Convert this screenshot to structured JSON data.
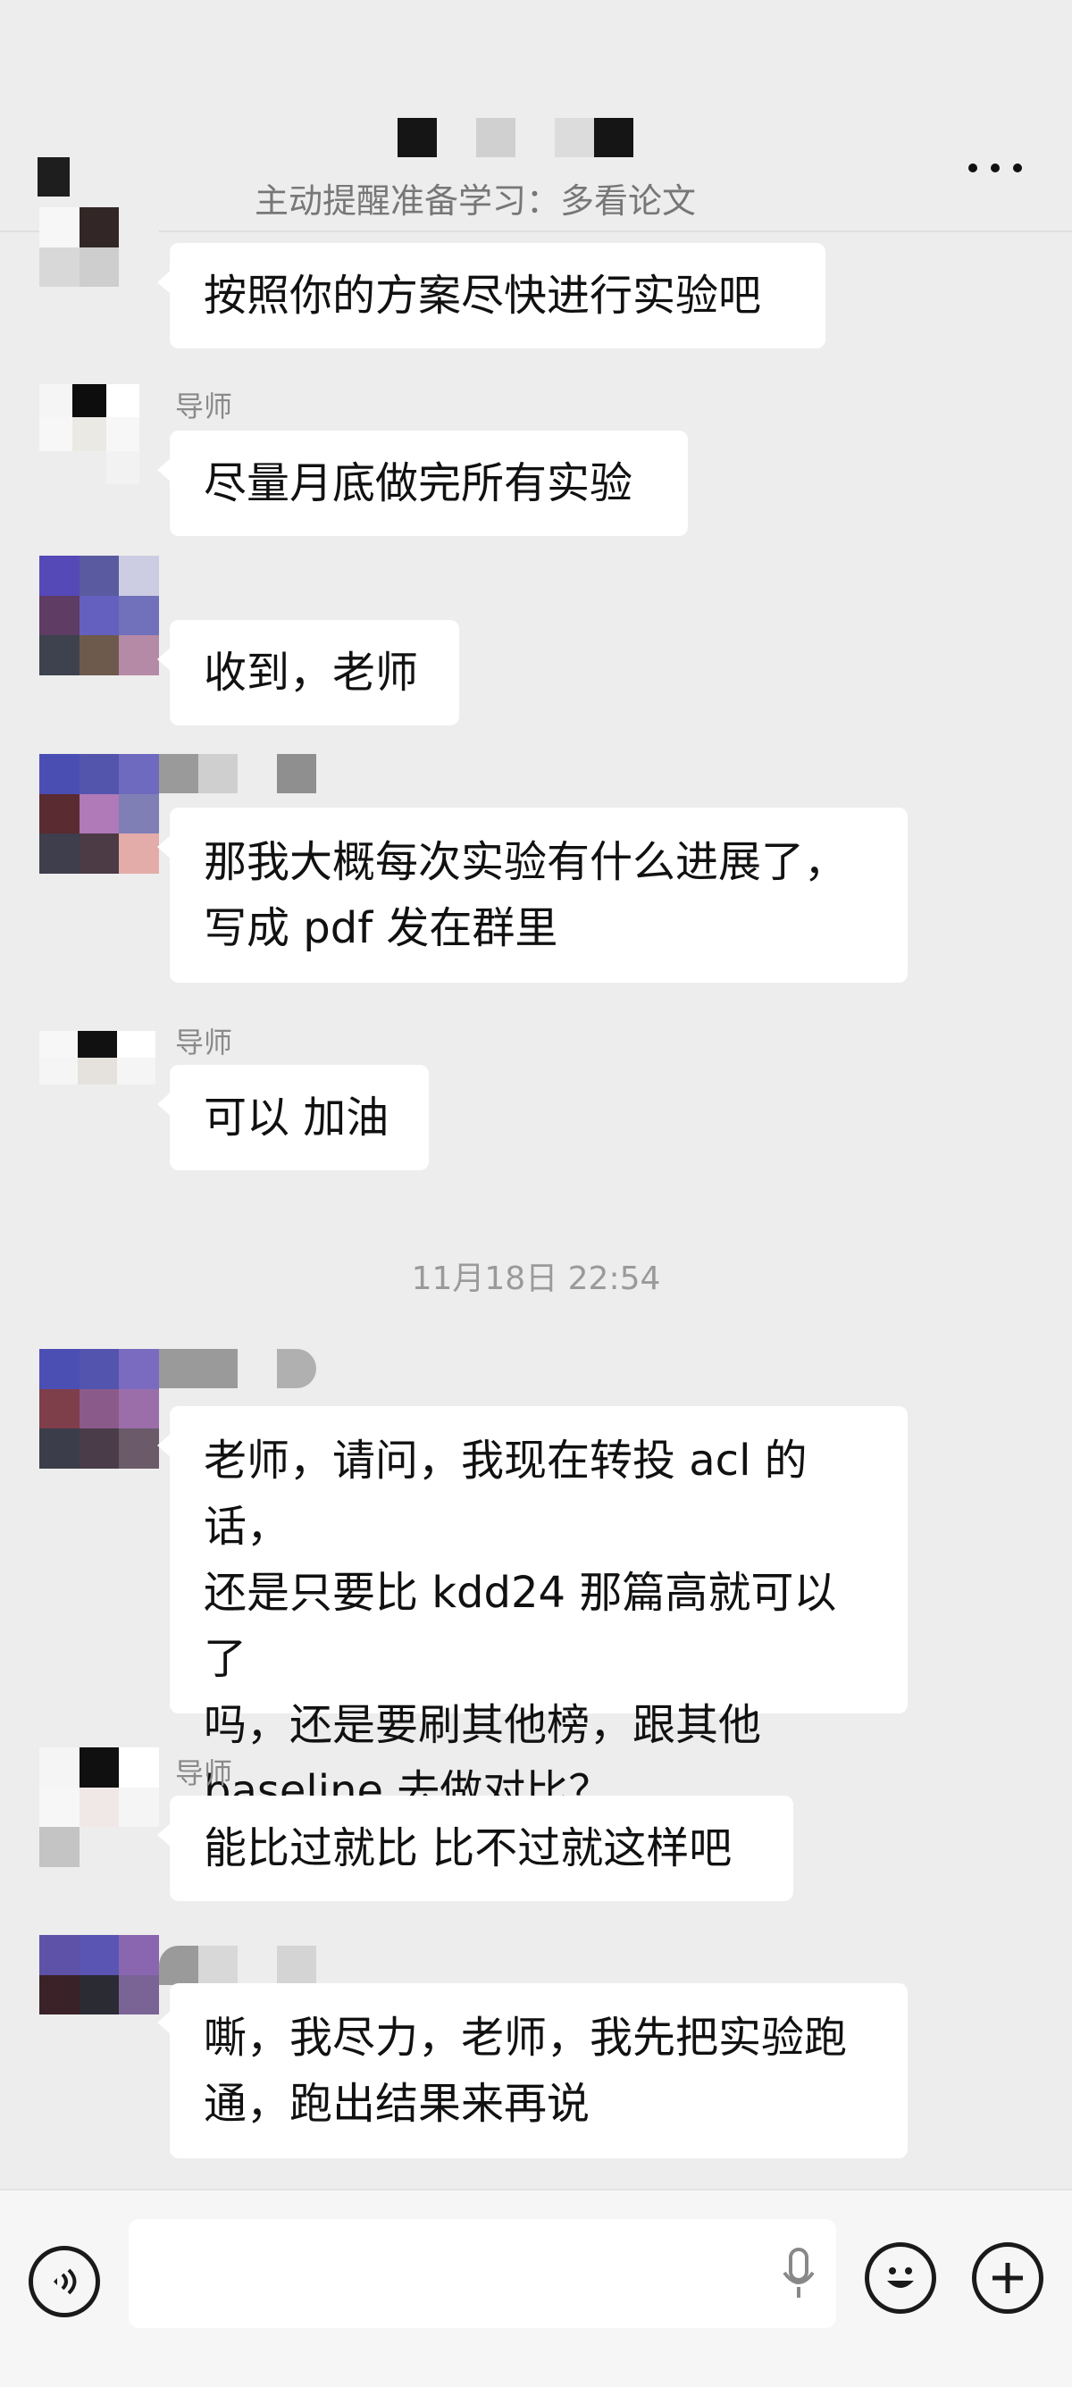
{
  "header": {
    "announcement": "主动提醒准备学习：多看论文",
    "title_blocks": [
      "#151515",
      "#ededed",
      "#d0d0d0",
      "#ededed",
      "#dcdcdc",
      "#151515"
    ]
  },
  "messages": [
    {
      "sender": "",
      "text": "按照你的方案尽快进行实验吧",
      "avatar": [
        "#f7f7f7",
        "#322726",
        "#ededed",
        "#d8d8d8",
        "#cecece",
        "#ededed",
        "#ededed",
        "#ededed",
        "#ededed"
      ]
    },
    {
      "sender": "导师",
      "text": "尽量月底做完所有实验",
      "avatar": [
        "#f5f5f5",
        "#0d0d0d",
        "#ffffff",
        "#f7f7f7",
        "#ebe9e4",
        "#f7f7f7",
        "#ededed",
        "#ededed",
        "#f2f2f2"
      ]
    },
    {
      "sender": "",
      "text": "收到，老师",
      "avatar": [
        "#5549b8",
        "#5a5aa0",
        "#cccde3",
        "#5e3c64",
        "#6360c0",
        "#7070bb",
        "#3e424e",
        "#6d5a4c",
        "#b58aa6"
      ]
    },
    {
      "sender": "",
      "text": "那我大概每次实验有什么进展了，\n写成 pdf 发在群里",
      "avatar": [
        "#4a4eb3",
        "#5355ad",
        "#6e6abf",
        "#5a2b30",
        "#b079b7",
        "#7f7fb6",
        "#3e3e4d",
        "#4c3a45",
        "#e3aca9"
      ]
    },
    {
      "sender": "导师",
      "text": "可以 加油",
      "avatar": [
        "#f7f7f7",
        "#111111",
        "#ffffff",
        "#f5f5f5",
        "#e5e2dd",
        "#f5f5f5",
        "#ededed",
        "#ededed",
        "#ededed"
      ]
    },
    {
      "sender": "",
      "text": "老师，请问，我现在转投 acl 的话，\n还是只要比 kdd24 那篇高就可以了\n吗，还是要刷其他榜，跟其他\nbaseline 去做对比？",
      "avatar": [
        "#4b4fb4",
        "#5354ae",
        "#7a6bc0",
        "#7e3e4a",
        "#8a5a8a",
        "#9b6eaa",
        "#3b3d4a",
        "#4a3c48",
        "#6a5a6a"
      ]
    },
    {
      "sender": "导师",
      "text": "能比过就比 比不过就这样吧",
      "avatar": [
        "#f5f5f5",
        "#101010",
        "#ffffff",
        "#f7f7f7",
        "#f0e8e6",
        "#f5f5f5",
        "#c4c4c4",
        "#ededed",
        "#ededed"
      ]
    },
    {
      "sender": "",
      "text": "嘶，我尽力，老师，我先把实验跑\n通，跑出结果来再说",
      "avatar": [
        "#5d52a8",
        "#5a55b2",
        "#8a66b0",
        "#3a2228",
        "#2b2b33",
        "#7a6496",
        "#ededed",
        "#ededed",
        "#ededed"
      ]
    }
  ],
  "timestamp": "11月18日 22:54",
  "input_bar": {
    "placeholder": "",
    "voice_icon": "voice-mode-icon",
    "mic_icon": "microphone-icon",
    "emoji_icon": "emoji-icon",
    "plus_icon": "plus-icon"
  }
}
